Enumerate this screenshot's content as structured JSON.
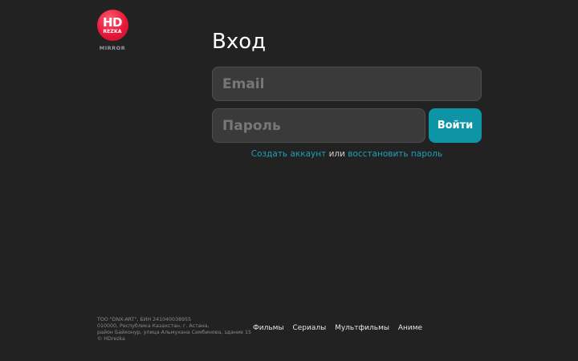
{
  "logo": {
    "top_text": "HD",
    "bottom_text": "REZKA",
    "caption": "MIRROR"
  },
  "login": {
    "title": "Вход",
    "email_placeholder": "Email",
    "password_placeholder": "Пароль",
    "submit_label": "Войти",
    "register_link": "Создать аккаунт",
    "separator": "или",
    "restore_link": "восстановить пароль"
  },
  "footer": {
    "info_lines": [
      "ТОО \"DNX-ART\", БИН 241040038955",
      "010000, Республика Казахстан, г. Астана,",
      "район Байконур, улица Альмухана Сембинова, здание 15",
      "© HDrezka"
    ],
    "nav": [
      "Фильмы",
      "Сериалы",
      "Мультфильмы",
      "Аниме"
    ]
  },
  "colors": {
    "background": "#222222",
    "accent": "#0d95a5",
    "link": "#1aa3b5",
    "logo_red": "#e8173a"
  }
}
